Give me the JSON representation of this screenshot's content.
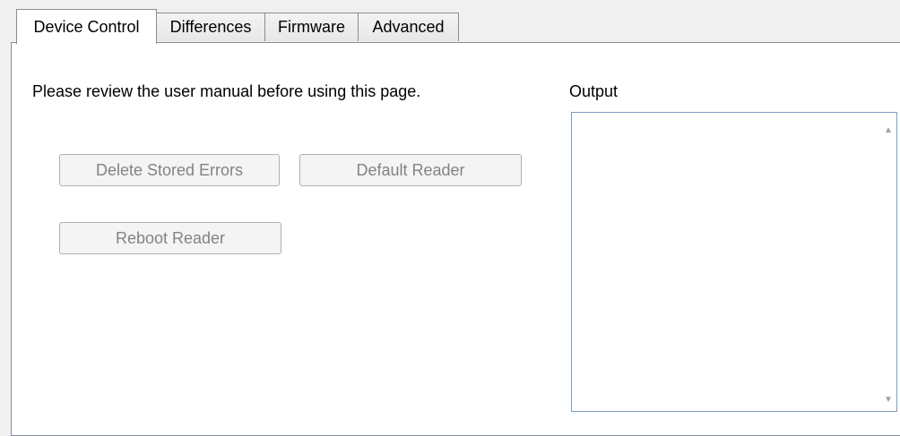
{
  "tabs": [
    {
      "label": "Device Control",
      "active": true
    },
    {
      "label": "Differences",
      "active": false
    },
    {
      "label": "Firmware",
      "active": false
    },
    {
      "label": "Advanced",
      "active": false
    }
  ],
  "panel": {
    "intro_text": "Please review the user manual before using this page.",
    "buttons": {
      "delete_errors": "Delete Stored Errors",
      "default_reader": "Default Reader",
      "reboot_reader": "Reboot Reader"
    },
    "output_label": "Output",
    "output_value": ""
  },
  "icons": {
    "scroll_up": "triangle-up",
    "scroll_down": "triangle-down"
  },
  "colors": {
    "disabled_text": "#838383",
    "border": "#898c95",
    "focus_border": "#7a9cc4"
  }
}
